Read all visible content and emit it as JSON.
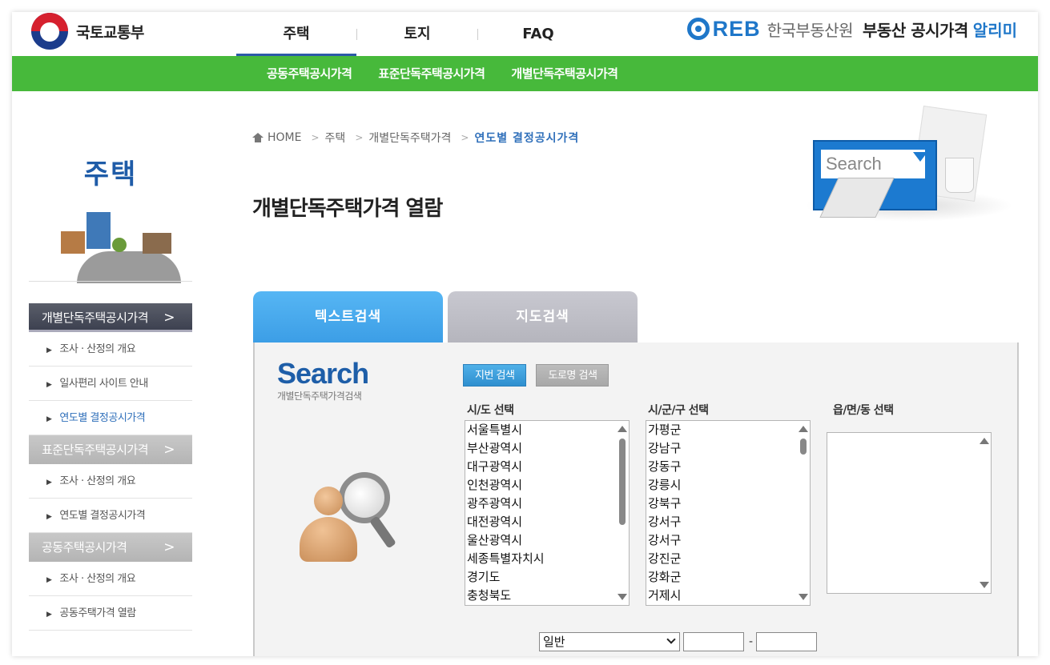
{
  "header": {
    "gov_name": "국토교통부",
    "main_nav": [
      "주택",
      "토지",
      "FAQ"
    ],
    "reb_letters": "REB",
    "reb_kname": "한국부동산원",
    "service_name": "부동산 공시가격",
    "service_accent": "알리미"
  },
  "subnav": [
    "공동주택공시가격",
    "표준단독주택공시가격",
    "개별단독주택공시가격"
  ],
  "sidebar": {
    "title": "주택",
    "groups": [
      {
        "label": "개별단독주택공시가격",
        "arrow": ">",
        "items": [
          "조사 · 산정의 개요",
          "일사편리 사이트 안내",
          "연도별 결정공시가격"
        ]
      },
      {
        "label": "표준단독주택공시가격",
        "arrow": ">",
        "items": [
          "조사 · 산정의 개요",
          "연도별 결정공시가격"
        ]
      },
      {
        "label": "공동주택공시가격",
        "arrow": ">",
        "items": [
          "조사 · 산정의 개요",
          "공동주택가격 열람"
        ]
      }
    ]
  },
  "breadcrumb": [
    "HOME",
    "주택",
    "개별단독주택가격",
    "연도별 결정공시가격"
  ],
  "page_title": "개별단독주택가격 열람",
  "hero": {
    "search_word": "Search"
  },
  "tabs": [
    "텍스트검색",
    "지도검색"
  ],
  "panel": {
    "logo_word": "Search",
    "logo_sub": "개별단독주택가격검색",
    "buttons": [
      "지번 검색",
      "도로명 검색"
    ],
    "col_labels": [
      "시/도 선택",
      "시/군/구 선택",
      "읍/면/동 선택"
    ],
    "sido_options": [
      "서울특별시",
      "부산광역시",
      "대구광역시",
      "인천광역시",
      "광주광역시",
      "대전광역시",
      "울산광역시",
      "세종특별자치시",
      "경기도",
      "충청북도"
    ],
    "sigungu_options": [
      "가평군",
      "강남구",
      "강동구",
      "강릉시",
      "강북구",
      "강서구",
      "강서구",
      "강진군",
      "강화군",
      "거제시"
    ],
    "select_value": "일반",
    "range_dash": "-"
  },
  "colors": {
    "green": "#47b93b",
    "blue": "#1f77c9",
    "tab_active": "#3c9ee6",
    "tab_inactive": "#b5b5bd"
  }
}
